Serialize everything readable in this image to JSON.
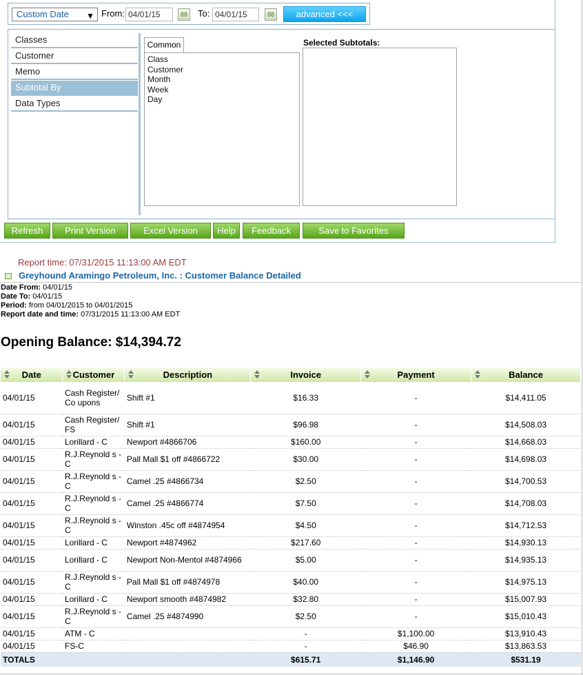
{
  "filters": {
    "date_range": "Custom Date",
    "from_label": "From:",
    "from_value": "04/01/15",
    "to_label": "To:",
    "to_value": "04/01/15",
    "calendar_icon_label": "88",
    "advanced_label": "advanced <<<"
  },
  "sidebar": {
    "items": [
      {
        "label": "Classes"
      },
      {
        "label": "Customer"
      },
      {
        "label": "Memo"
      },
      {
        "label": "Subtotal By"
      },
      {
        "label": "Data Types"
      }
    ]
  },
  "subtotal": {
    "tab_label": "Common",
    "fields": [
      "Class",
      "Customer",
      "Month",
      "Week",
      "Day"
    ],
    "selected_title": "Selected Subtotals:"
  },
  "toolbar": {
    "refresh": "Refresh",
    "print": "Print Version",
    "excel": "Excel Version",
    "help": "Help",
    "feedback": "Feedback",
    "favorites": "Save to Favorites"
  },
  "report": {
    "report_time": "Report time: 07/31/2015 11:13:00 AM EDT",
    "title": "Greyhound Aramingo Petroleum, Inc. : Customer Balance Detailed",
    "date_from_label": "Date From:",
    "date_from": "04/01/15",
    "date_to_label": "Date To:",
    "date_to": "04/01/15",
    "period_label": "Period:",
    "period": "from 04/01/2015 to 04/01/2015",
    "report_dt_label": "Report date and time:",
    "report_dt": "07/31/2015 11:13:00 AM EDT",
    "opening_balance": "Opening Balance: $14,394.72"
  },
  "table": {
    "headers": [
      "Date",
      "Customer",
      "Description",
      "Invoice",
      "Payment",
      "Balance"
    ],
    "rows": [
      {
        "date": "04/01/15",
        "customer": "Cash Register/Co upons",
        "description": "Shift #1",
        "invoice": "$16.33",
        "payment": "-",
        "balance": "$14,411.05"
      },
      {
        "date": "04/01/15",
        "customer": "Cash Register/FS",
        "description": "Shift #1",
        "invoice": "$96.98",
        "payment": "-",
        "balance": "$14,508.03"
      },
      {
        "date": "04/01/15",
        "customer": "Lorillard - C",
        "description": "Newport #4866706",
        "invoice": "$160.00",
        "payment": "-",
        "balance": "$14,668.03"
      },
      {
        "date": "04/01/15",
        "customer": "R.J.Reynold s - C",
        "description": "Pall Mall $1 off #4866722",
        "invoice": "$30.00",
        "payment": "-",
        "balance": "$14,698.03"
      },
      {
        "date": "04/01/15",
        "customer": "R.J.Reynold s - C",
        "description": "Camel .25 #4866734",
        "invoice": "$2.50",
        "payment": "-",
        "balance": "$14,700.53"
      },
      {
        "date": "04/01/15",
        "customer": "R.J.Reynold s - C",
        "description": "Camel .25 #4866774",
        "invoice": "$7.50",
        "payment": "-",
        "balance": "$14,708.03"
      },
      {
        "date": "04/01/15",
        "customer": "R.J.Reynold s - C",
        "description": "Winston .45c off #4874954",
        "invoice": "$4.50",
        "payment": "-",
        "balance": "$14,712.53"
      },
      {
        "date": "04/01/15",
        "customer": "Lorillard - C",
        "description": "Newport #4874962",
        "invoice": "$217.60",
        "payment": "-",
        "balance": "$14,930.13"
      },
      {
        "date": "04/01/15",
        "customer": "Lorillard - C",
        "description": "Newport Non-Mentol #4874966",
        "invoice": "$5.00",
        "payment": "-",
        "balance": "$14,935.13"
      },
      {
        "date": "04/01/15",
        "customer": "R.J.Reynold s - C",
        "description": "Pall Mall $1 off #4874978",
        "invoice": "$40.00",
        "payment": "-",
        "balance": "$14,975.13"
      },
      {
        "date": "04/01/15",
        "customer": "Lorillard - C",
        "description": "Newport smooth #4874982",
        "invoice": "$32.80",
        "payment": "-",
        "balance": "$15,007.93"
      },
      {
        "date": "04/01/15",
        "customer": "R.J.Reynold s - C",
        "description": "Camel .25 #4874990",
        "invoice": "$2.50",
        "payment": "-",
        "balance": "$15,010.43"
      },
      {
        "date": "04/01/15",
        "customer": "ATM - C",
        "description": "",
        "invoice": "-",
        "payment": "$1,100.00",
        "balance": "$13,910.43"
      },
      {
        "date": "04/01/15",
        "customer": "FS-C",
        "description": "",
        "invoice": "-",
        "payment": "$46.90",
        "balance": "$13,863.53"
      }
    ],
    "totals": {
      "label": "TOTALS",
      "invoice": "$615.71",
      "payment": "$1,146.90",
      "balance": "$531.19"
    }
  }
}
